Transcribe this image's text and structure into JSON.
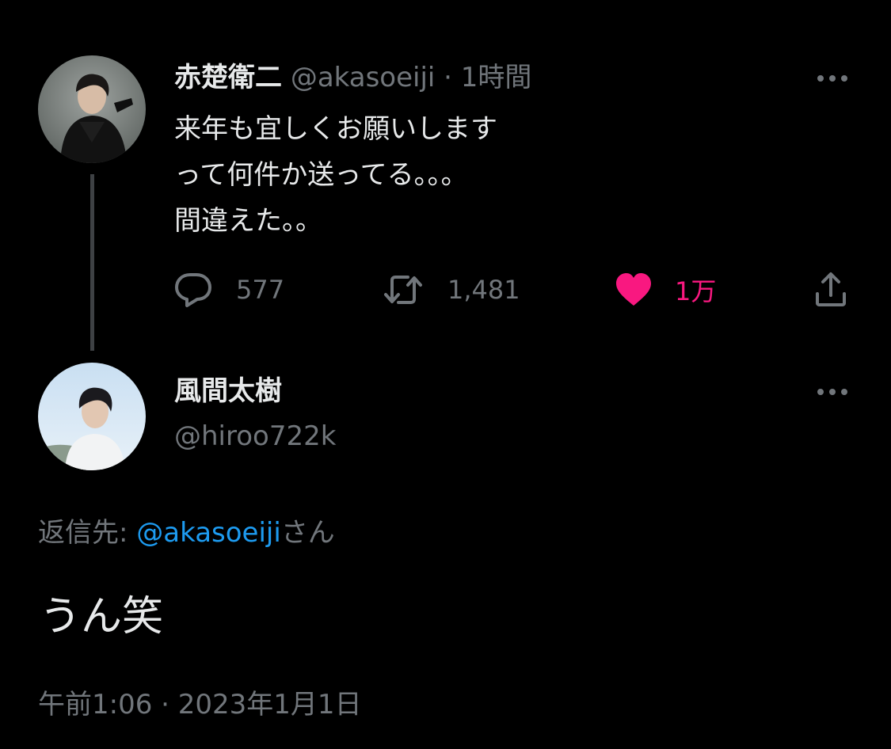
{
  "tweet1": {
    "name": "赤楚衛二",
    "handle": "@akasoeiji",
    "separator": "·",
    "time": "1時間",
    "text_lines": [
      "来年も宜しくお願いします",
      "って何件か送ってる。。。",
      "間違えた。。"
    ],
    "actions": {
      "replies": "577",
      "retweets": "1,481",
      "likes": "1万"
    },
    "liked": true
  },
  "tweet2": {
    "name": "風間太樹",
    "handle": "@hiroo722k",
    "reply_prefix": "返信先: ",
    "reply_mention": "@akasoeiji",
    "reply_suffix": "さん",
    "text": "うん笑",
    "timestamp": "午前1:06 · 2023年1月1日"
  },
  "colors": {
    "background": "#000000",
    "primary_text": "#e7e9ea",
    "secondary_text": "#71767b",
    "like_pink": "#f91880",
    "mention_blue": "#1d9bf0",
    "thread_line": "#3e4144"
  },
  "icons": {
    "reply": "reply-icon",
    "retweet": "retweet-icon",
    "like": "heart-icon",
    "share": "share-icon",
    "more": "more-icon"
  }
}
